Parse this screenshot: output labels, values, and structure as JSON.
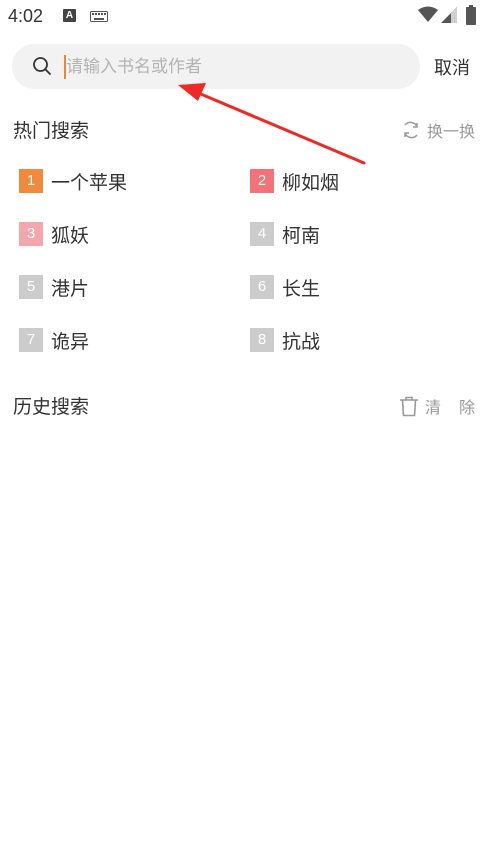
{
  "status_bar": {
    "time": "4:02",
    "a_label": "A"
  },
  "search": {
    "placeholder": "请输入书名或作者",
    "value": "",
    "cancel_label": "取消"
  },
  "hot_search": {
    "title": "热门搜索",
    "refresh_label": "换一换",
    "items": [
      {
        "rank": "1",
        "label": "一个苹果",
        "color": "#f08a3c"
      },
      {
        "rank": "2",
        "label": "柳如烟",
        "color": "#f3727a"
      },
      {
        "rank": "3",
        "label": "狐妖",
        "color": "#f4a6ad"
      },
      {
        "rank": "4",
        "label": "柯南",
        "color": "#cccccc"
      },
      {
        "rank": "5",
        "label": "港片",
        "color": "#cccccc"
      },
      {
        "rank": "6",
        "label": "长生",
        "color": "#cccccc"
      },
      {
        "rank": "7",
        "label": "诡异",
        "color": "#cccccc"
      },
      {
        "rank": "8",
        "label": "抗战",
        "color": "#cccccc"
      }
    ]
  },
  "history_search": {
    "title": "历史搜索",
    "clear_char_1": "清",
    "clear_char_2": "除"
  },
  "colors": {
    "accent_caret": "#e8873a",
    "annotation_arrow": "#ee2a24"
  }
}
